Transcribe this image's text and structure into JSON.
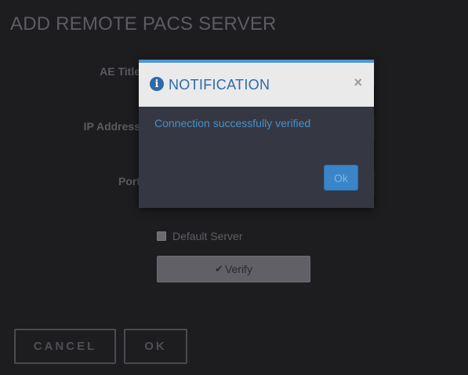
{
  "page": {
    "title": "ADD REMOTE PACS SERVER"
  },
  "form": {
    "ae_title_label": "AE Title",
    "ip_address_label": "IP Address",
    "port_label": "Port",
    "ae_title_value": "",
    "ip_address_value": "",
    "port_value": "",
    "default_server_label": "Default Server",
    "default_server_checked": false,
    "verify_label": "Verify",
    "verify_icon": "check-icon"
  },
  "footer": {
    "cancel_label": "CANCEL",
    "ok_label": "OK"
  },
  "modal": {
    "title": "NOTIFICATION",
    "info_icon_glyph": "i",
    "close_glyph": "×",
    "message": "Connection successfully verified",
    "ok_label": "Ok"
  },
  "colors": {
    "background": "#1d1d20",
    "modal_accent": "#4f95d6",
    "modal_title": "#2d6aa8",
    "message_text": "#4a8fc9",
    "ok_button": "#3a85c8"
  }
}
